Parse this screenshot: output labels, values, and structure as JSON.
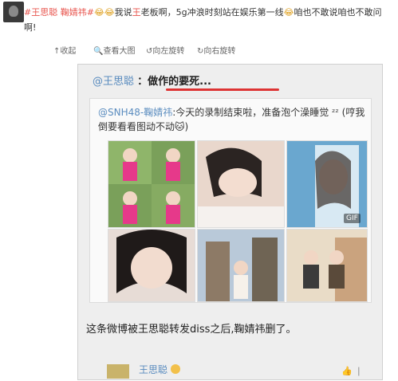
{
  "post": {
    "tag1": "#王思聪",
    "tag2": "鞠婧祎#",
    "text_a": "我说",
    "text_a_red": "王",
    "text_b": "老板啊，5g冲浪时刻站在娱乐第一线",
    "text_c": "咱也不敢说咱也不敢问",
    "text_d": "啊!"
  },
  "toolbar": {
    "collapse": "收起",
    "view_large": "查看大图",
    "rotate_left": "向左旋转",
    "rotate_right": "向右旋转"
  },
  "nested": {
    "author": "@王思聪",
    "quote": "：做作的要死..."
  },
  "repost": {
    "author": "@SNH48-鞠婧祎",
    "text": ":今天的录制结束啦，准备泡个澡睡觉 ᶻᶻ (哼我倒要看看图动不动"
  },
  "photos": {
    "gif_label": "GIF"
  },
  "caption": "这条微博被王思聪转发diss之后,鞠婧祎删了。",
  "comment": {
    "name": "王思聪",
    "like": "👍 ❘"
  },
  "colors": {
    "link": "#5a8cbf",
    "tag": "#e8554e",
    "underline": "#d33333"
  }
}
